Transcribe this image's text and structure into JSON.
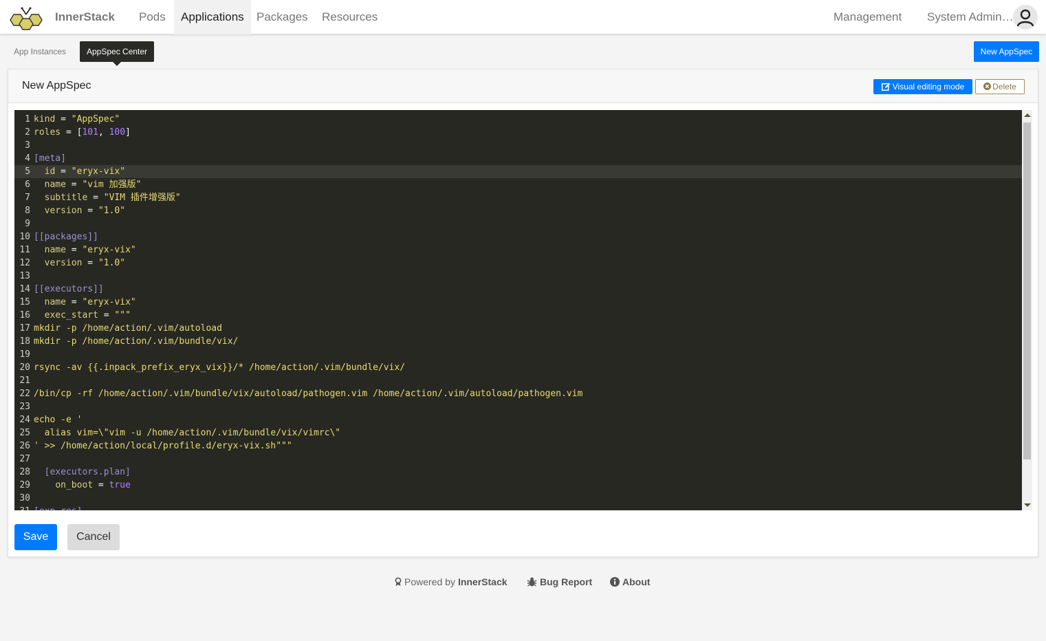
{
  "nav": {
    "brand": "InnerStack",
    "items": [
      {
        "label": "Pods",
        "active": false
      },
      {
        "label": "Applications",
        "active": true
      },
      {
        "label": "Packages",
        "active": false
      },
      {
        "label": "Resources",
        "active": false
      }
    ],
    "management": "Management",
    "user": "System Admin…"
  },
  "subnav": {
    "items": [
      {
        "label": "App Instances",
        "active": false
      },
      {
        "label": "AppSpec Center",
        "active": true
      }
    ],
    "new_button": "New AppSpec"
  },
  "card": {
    "title": "New AppSpec",
    "visual_button": "Visual editing mode",
    "delete_button": "Delete",
    "save_button": "Save",
    "cancel_button": "Cancel"
  },
  "editor": {
    "active_line": 5,
    "lines": [
      "kind = \"AppSpec\"",
      "roles = [101, 100]",
      "",
      "[meta]",
      "  id = \"eryx-vix\"",
      "  name = \"vim 加强版\"",
      "  subtitle = \"VIM 插件增强版\"",
      "  version = \"1.0\"",
      "",
      "[[packages]]",
      "  name = \"eryx-vix\"",
      "  version = \"1.0\"",
      "",
      "[[executors]]",
      "  name = \"eryx-vix\"",
      "  exec_start = \"\"\"",
      "mkdir -p /home/action/.vim/autoload",
      "mkdir -p /home/action/.vim/bundle/vix/",
      "",
      "rsync -av {{.inpack_prefix_eryx_vix}}/* /home/action/.vim/bundle/vix/",
      "",
      "/bin/cp -rf /home/action/.vim/bundle/vix/autoload/pathogen.vim /home/action/.vim/autoload/pathogen.vim",
      "",
      "echo -e '",
      "  alias vim=\\\"vim -u /home/action/.vim/bundle/vix/vimrc\\\"",
      "' >> /home/action/local/profile.d/eryx-vix.sh\"\"\"",
      "",
      "  [executors.plan]",
      "    on_boot = true",
      "",
      "[exp_res]"
    ]
  },
  "footer": {
    "powered_prefix": "Powered by",
    "powered_brand": "InnerStack",
    "bug_report": "Bug Report",
    "about": "About"
  },
  "colors": {
    "primary": "#007bff",
    "editor_bg": "#272822",
    "string": "#e6db74",
    "number": "#ae81ff",
    "section": "#9c8fd8",
    "delete_border": "#a08c5a"
  }
}
